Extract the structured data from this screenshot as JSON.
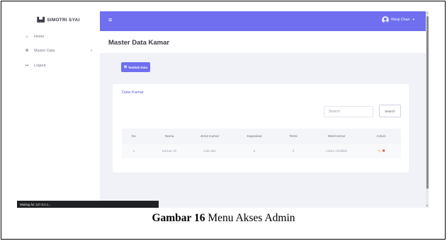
{
  "brand": {
    "icon": "hospital-icon",
    "name": "SIMOTRI SYAI"
  },
  "sidebar": {
    "items": [
      {
        "icon": "home-icon",
        "label": "Home"
      },
      {
        "icon": "list-icon",
        "label": "Master Data",
        "chevron": "›"
      },
      {
        "icon": "logout-icon",
        "label": "Logout"
      }
    ]
  },
  "topbar": {
    "menu_icon": "≡",
    "user_name": "Rizqi Chan",
    "caret": "▾",
    "color": "#6f6ff0"
  },
  "page": {
    "title": "Master Data Kamar",
    "add_button": "Tambah Data",
    "add_icon": "⊞"
  },
  "card": {
    "title": "Data Kamar",
    "search_placeholder": "Search",
    "search_button": "Search",
    "table": {
      "headers": [
        "No",
        "Nama",
        "Jenis Kamar",
        "Kapasitas",
        "Terisi",
        "Wali Kamar",
        "Action"
      ],
      "rows": [
        [
          "1",
          "Kamar Ali",
          "Laki-laki",
          "5",
          "3",
          "Adam Abdillah"
        ]
      ]
    }
  },
  "status_bar": "Waiting for 127.0.0.1...",
  "caption": {
    "prefix": "Gambar 16",
    "text": "Menu Akses Admin"
  }
}
